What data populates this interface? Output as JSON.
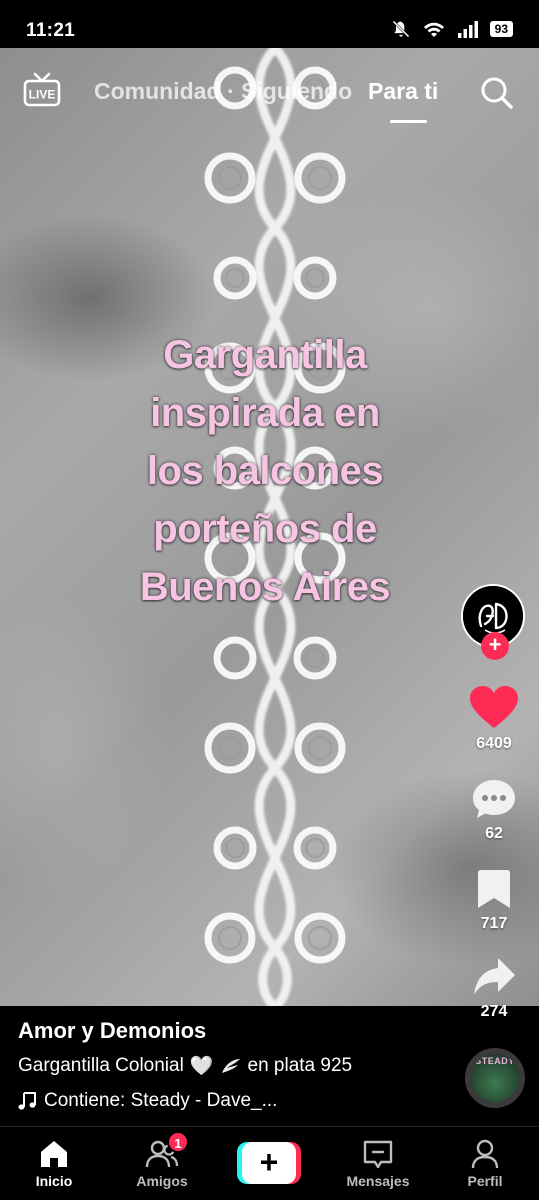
{
  "status_bar": {
    "time": "11:21",
    "battery": "93",
    "icons": [
      "mute-icon",
      "wifi-icon",
      "signal-icon"
    ]
  },
  "top_nav": {
    "live_label": "LIVE",
    "tabs": [
      {
        "label": "Comunidad",
        "active": false
      },
      {
        "label": "Siguiendo",
        "active": false
      },
      {
        "label": "Para ti",
        "active": true
      }
    ],
    "separator": "·"
  },
  "video": {
    "overlay_lines": [
      "Gargantilla",
      "inspirada en",
      "los balcones",
      "porteños de",
      "Buenos Aires"
    ]
  },
  "side_rail": {
    "avatar_initials": "AD",
    "likes": "6409",
    "comments": "62",
    "saves": "717",
    "shares": "274",
    "like_color": "#fe2c55"
  },
  "post": {
    "username": "Amor y Demonios",
    "caption_start": "Gargantilla Colonial",
    "caption_emojis": "🤍",
    "caption_end": "en plata 925",
    "music": "Contiene: Steady - Dave_...",
    "disc_label": "STEADY"
  },
  "bottom_nav": {
    "items": [
      {
        "label": "Inicio",
        "active": true
      },
      {
        "label": "Amigos",
        "active": false,
        "badge": "1"
      },
      {
        "label": "Mensajes",
        "active": false
      },
      {
        "label": "Perfil",
        "active": false
      }
    ],
    "create_label": "+"
  }
}
